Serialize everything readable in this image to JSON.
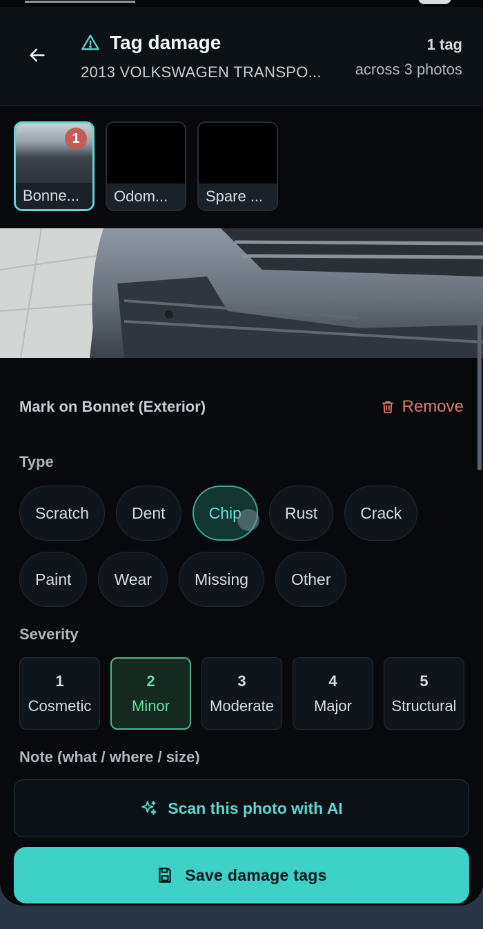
{
  "header": {
    "title": "Tag damage",
    "subtitle": "2013 VOLKSWAGEN TRANSPO...",
    "tag_count": "1 tag",
    "across": "across 3 photos"
  },
  "thumbnails": [
    {
      "label": "Bonne...",
      "badge": "1"
    },
    {
      "label": "Odom..."
    },
    {
      "label": "Spare ..."
    }
  ],
  "mark": {
    "title": "Mark on Bonnet (Exterior)",
    "remove_label": "Remove"
  },
  "type": {
    "label": "Type",
    "options": [
      "Scratch",
      "Dent",
      "Chip",
      "Rust",
      "Crack",
      "Paint",
      "Wear",
      "Missing",
      "Other"
    ],
    "selected": "Chip"
  },
  "severity": {
    "label": "Severity",
    "options": [
      {
        "num": "1",
        "name": "Cosmetic"
      },
      {
        "num": "2",
        "name": "Minor"
      },
      {
        "num": "3",
        "name": "Moderate"
      },
      {
        "num": "4",
        "name": "Major"
      },
      {
        "num": "5",
        "name": "Structural"
      }
    ],
    "selected": "2"
  },
  "note": {
    "label": "Note (what / where / size)"
  },
  "actions": {
    "scan_label": "Scan this photo with AI",
    "save_label": "Save damage tags"
  },
  "colors": {
    "accent": "#3dd1c7",
    "chip_selected": "#6fe0d6",
    "severity_selected": "#6fd99f",
    "remove": "#e07a72",
    "badge": "#c35b57"
  }
}
